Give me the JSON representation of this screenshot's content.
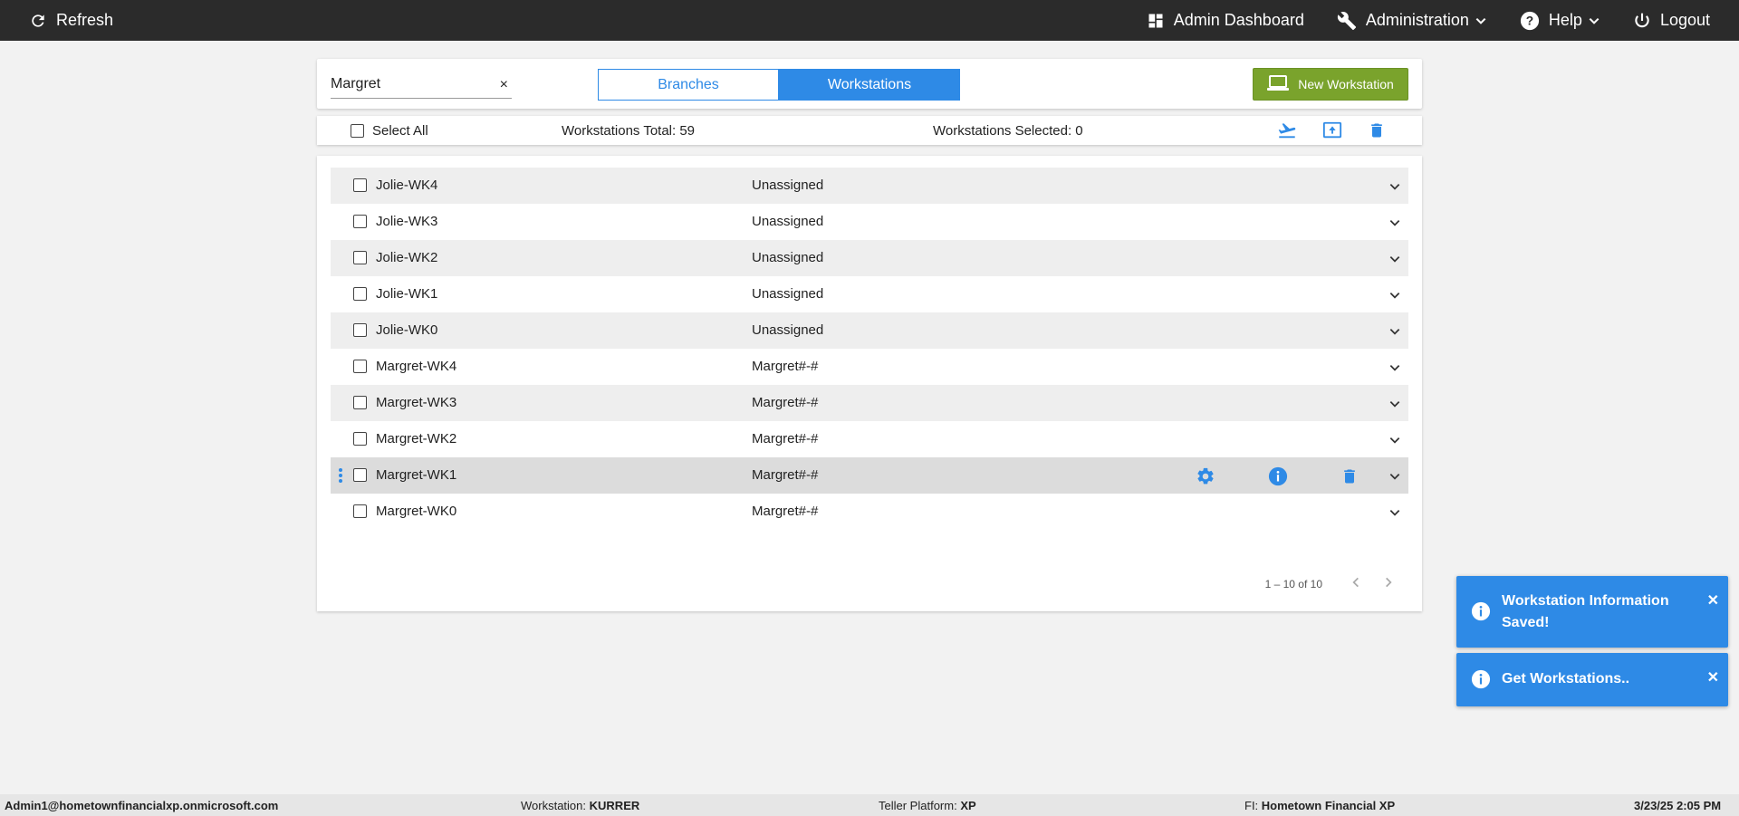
{
  "topbar": {
    "refresh": "Refresh",
    "admin_dashboard": "Admin Dashboard",
    "administration": "Administration",
    "help": "Help",
    "logout": "Logout"
  },
  "filter": {
    "search_value": "Margret",
    "clear": "×",
    "tab_branches": "Branches",
    "tab_workstations": "Workstations",
    "new_workstation": "New Workstation"
  },
  "selectbar": {
    "select_all": "Select All",
    "total": "Workstations Total: 59",
    "selected": "Workstations Selected: 0"
  },
  "rows": [
    {
      "name": "Jolie-WK4",
      "branch": "Unassigned"
    },
    {
      "name": "Jolie-WK3",
      "branch": "Unassigned"
    },
    {
      "name": "Jolie-WK2",
      "branch": "Unassigned"
    },
    {
      "name": "Jolie-WK1",
      "branch": "Unassigned"
    },
    {
      "name": "Jolie-WK0",
      "branch": "Unassigned"
    },
    {
      "name": "Margret-WK4",
      "branch": "Margret#-#"
    },
    {
      "name": "Margret-WK3",
      "branch": "Margret#-#"
    },
    {
      "name": "Margret-WK2",
      "branch": "Margret#-#"
    },
    {
      "name": "Margret-WK1",
      "branch": "Margret#-#"
    },
    {
      "name": "Margret-WK0",
      "branch": "Margret#-#"
    }
  ],
  "pager": {
    "range": "1 – 10 of 10"
  },
  "toasts": [
    {
      "text_line1": "Workstation Information",
      "text_line2": "Saved!"
    },
    {
      "text_line1": "Get Workstations.."
    }
  ],
  "status": {
    "user": "Admin1@hometownfinancialxp.onmicrosoft.com",
    "workstation_label": "Workstation:",
    "workstation_value": "KURRER",
    "platform_label": "Teller Platform:",
    "platform_value": "XP",
    "fi_label": "FI:",
    "fi_value": "Hometown Financial XP",
    "datetime": "3/23/25 2:05 PM"
  },
  "colors": {
    "accent": "#2e8ae6",
    "topbar": "#2b2b2b",
    "new_button": "#7aa32c"
  }
}
